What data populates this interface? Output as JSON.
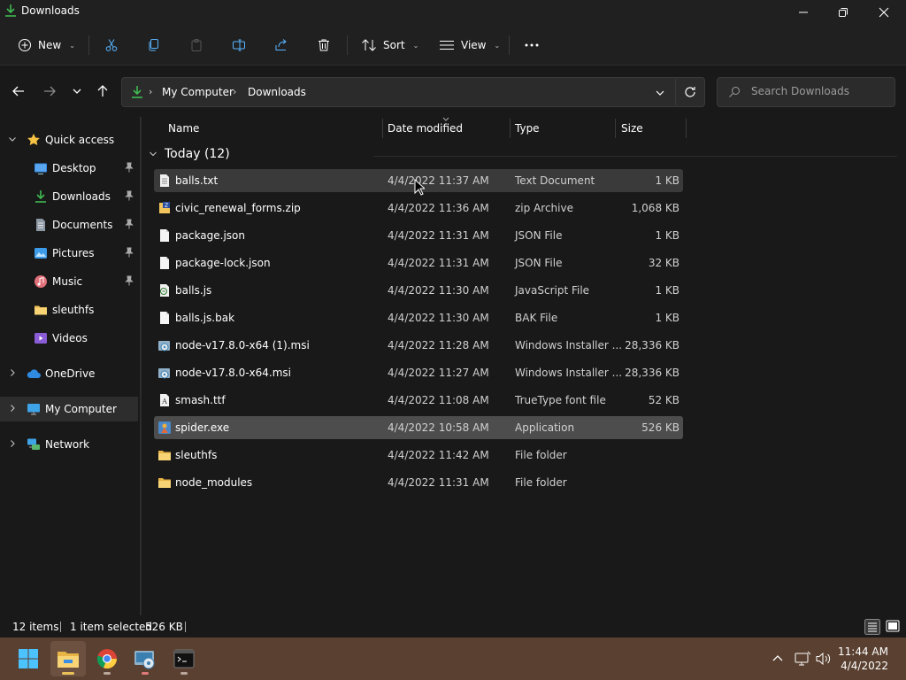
{
  "window": {
    "title": "Downloads"
  },
  "toolbar": {
    "new_label": "New",
    "sort_label": "Sort",
    "view_label": "View"
  },
  "address": {
    "segments": [
      "My Computer",
      "Downloads"
    ]
  },
  "search": {
    "placeholder": "Search Downloads"
  },
  "sidebar": {
    "items": [
      {
        "label": "Quick access",
        "icon": "star-icon"
      },
      {
        "label": "Desktop",
        "icon": "desktop-icon"
      },
      {
        "label": "Downloads",
        "icon": "download-icon"
      },
      {
        "label": "Documents",
        "icon": "documents-icon"
      },
      {
        "label": "Pictures",
        "icon": "pictures-icon"
      },
      {
        "label": "Music",
        "icon": "music-icon"
      },
      {
        "label": "sleuthfs",
        "icon": "folder-icon"
      },
      {
        "label": "Videos",
        "icon": "videos-icon"
      },
      {
        "label": "OneDrive",
        "icon": "cloud-icon"
      },
      {
        "label": "My Computer",
        "icon": "computer-icon"
      },
      {
        "label": "Network",
        "icon": "network-icon"
      }
    ]
  },
  "columns": {
    "name": "Name",
    "date": "Date modified",
    "type": "Type",
    "size": "Size"
  },
  "group": {
    "label": "Today (12)"
  },
  "files": [
    {
      "name": "balls.txt",
      "date": "4/4/2022 11:37 AM",
      "type": "Text Document",
      "size": "1 KB",
      "icon": "text-file-icon"
    },
    {
      "name": "civic_renewal_forms.zip",
      "date": "4/4/2022 11:36 AM",
      "type": "zip Archive",
      "size": "1,068 KB",
      "icon": "zip-file-icon"
    },
    {
      "name": "package.json",
      "date": "4/4/2022 11:31 AM",
      "type": "JSON File",
      "size": "1 KB",
      "icon": "blank-file-icon"
    },
    {
      "name": "package-lock.json",
      "date": "4/4/2022 11:31 AM",
      "type": "JSON File",
      "size": "32 KB",
      "icon": "blank-file-icon"
    },
    {
      "name": "balls.js",
      "date": "4/4/2022 11:30 AM",
      "type": "JavaScript File",
      "size": "1 KB",
      "icon": "script-file-icon"
    },
    {
      "name": "balls.js.bak",
      "date": "4/4/2022 11:30 AM",
      "type": "BAK File",
      "size": "1 KB",
      "icon": "blank-file-icon"
    },
    {
      "name": "node-v17.8.0-x64 (1).msi",
      "date": "4/4/2022 11:28 AM",
      "type": "Windows Installer ...",
      "size": "28,336 KB",
      "icon": "installer-file-icon"
    },
    {
      "name": "node-v17.8.0-x64.msi",
      "date": "4/4/2022 11:27 AM",
      "type": "Windows Installer ...",
      "size": "28,336 KB",
      "icon": "installer-file-icon"
    },
    {
      "name": "smash.ttf",
      "date": "4/4/2022 11:08 AM",
      "type": "TrueType font file",
      "size": "52 KB",
      "icon": "font-file-icon"
    },
    {
      "name": "spider.exe",
      "date": "4/4/2022 10:58 AM",
      "type": "Application",
      "size": "526 KB",
      "icon": "application-icon"
    },
    {
      "name": "sleuthfs",
      "date": "4/4/2022 11:42 AM",
      "type": "File folder",
      "size": "",
      "icon": "folder-icon"
    },
    {
      "name": "node_modules",
      "date": "4/4/2022 11:31 AM",
      "type": "File folder",
      "size": "",
      "icon": "folder-icon"
    }
  ],
  "status": {
    "items_count": "12 items",
    "selection": "1 item selected",
    "selection_size": "526 KB"
  },
  "clock": {
    "time": "11:44 AM",
    "date": "4/4/2022"
  },
  "colors": {
    "accent": "#4cc2ff",
    "folder": "#f2c55c",
    "taskbar": "#5a4030",
    "download_green": "#3fb950"
  }
}
